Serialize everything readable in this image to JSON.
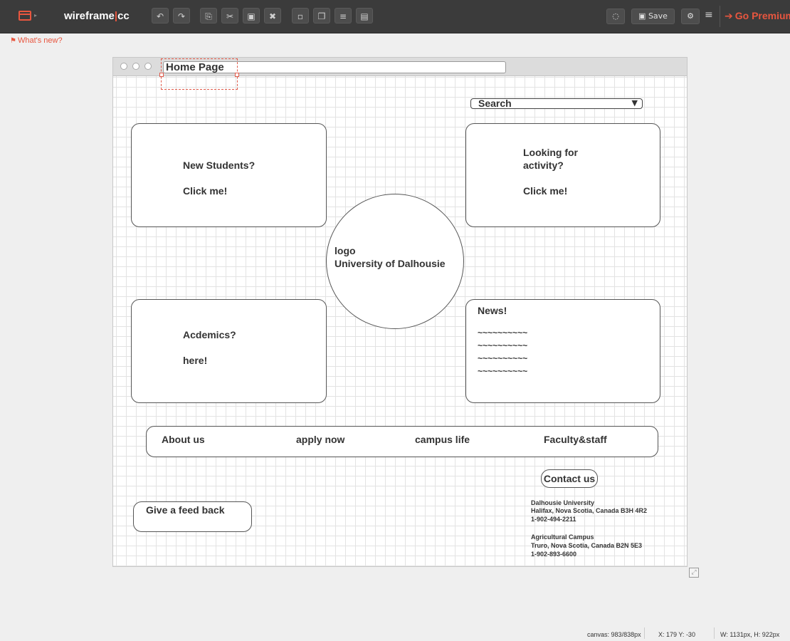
{
  "app": {
    "brand_main": "wireframe",
    "brand_bar": "|",
    "brand_suffix": "cc",
    "save_label": "Save",
    "save_icon": "floppy-icon",
    "premium_label": "Go Premium",
    "whats_new": "What's new?",
    "accent_color": "#e8563f"
  },
  "toolbar": {
    "icons": [
      "undo-icon",
      "redo-icon",
      "copy-icon",
      "cut-icon",
      "paste-icon",
      "delete-icon",
      "lock-icon",
      "arrange-icon",
      "align-icon",
      "group-icon"
    ],
    "right_icons": [
      "comment-icon",
      "settings-icon",
      "menu-icon"
    ]
  },
  "wireframe": {
    "page_title": "Home Page",
    "search": {
      "label": "Search"
    },
    "new_students": {
      "line1": "New Students?",
      "line2": "Click me!"
    },
    "activity": {
      "line1": "Looking for",
      "line2": "activity?",
      "line3": "Click me!"
    },
    "logo": {
      "line1": "logo",
      "line2": "University of Dalhousie"
    },
    "academics": {
      "line1": "Acdemics?",
      "line2": "here!"
    },
    "news": {
      "title": "News!",
      "lines": [
        "~~~~~~~~~~",
        "~~~~~~~~~~",
        "~~~~~~~~~~",
        "~~~~~~~~~~"
      ]
    },
    "nav": [
      "About us",
      "apply now",
      "campus life",
      "Faculty&staff"
    ],
    "contact_label": "Contact us",
    "feedback_label": "Give a feed back",
    "address_main": [
      "Dalhousie University",
      "Halifax, Nova Scotia, Canada B3H 4R2",
      "1-902-494-2211"
    ],
    "address_agri": [
      "Agricultural Campus",
      "Truro, Nova Scotia, Canada B2N 5E3",
      "1-902-893-6600"
    ]
  },
  "status": {
    "canvas_label": "canvas:",
    "canvas_value": "983/838px",
    "x_label": "X:",
    "x_value": "179",
    "y_label": "Y:",
    "y_value": "-30",
    "w_label": "W:",
    "w_value": "1131px,",
    "h_label": "H:",
    "h_value": "922px"
  }
}
